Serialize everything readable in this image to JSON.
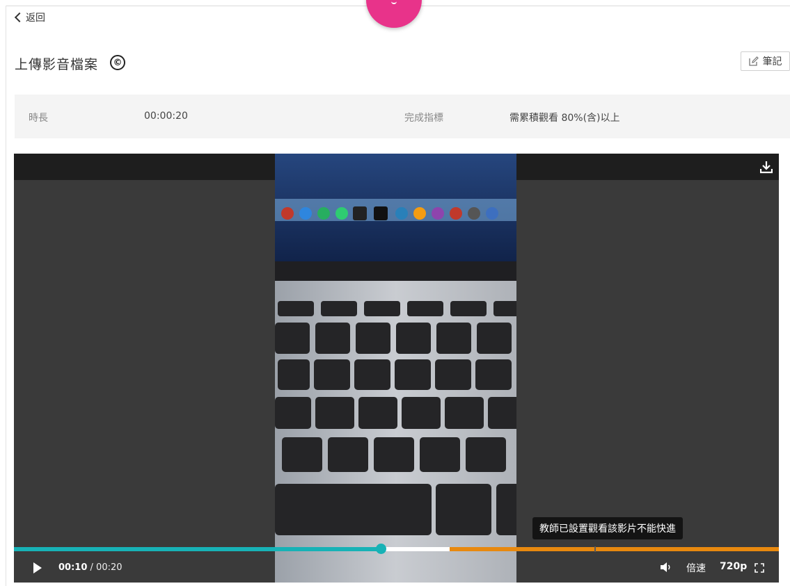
{
  "nav": {
    "back_label": "返回"
  },
  "header": {
    "title": "上傳影音檔案",
    "copyright_symbol": "©",
    "notes_label": "筆記"
  },
  "info": {
    "duration_label": "時長",
    "duration_value": "00:00:20",
    "completion_label": "完成指標",
    "completion_value": "需累積觀看 80%(含)以上"
  },
  "player": {
    "tooltip": "教師已設置觀看該影片不能快進",
    "current_time": "00:10",
    "separator": " / ",
    "total_time": "00:20",
    "speed_label": "倍速",
    "quality_label": "720p",
    "played_fraction": 0.5,
    "buffered_fraction": 0.57
  },
  "colors": {
    "accent_teal": "#17b2b6",
    "progress_orange": "#e8890f",
    "bubble_pink": "#e8338a",
    "player_bg": "#3a3a3a"
  },
  "icons": [
    "chevron-left-icon",
    "copyright-icon",
    "edit-icon",
    "download-icon",
    "play-icon",
    "volume-icon",
    "fullscreen-icon"
  ]
}
